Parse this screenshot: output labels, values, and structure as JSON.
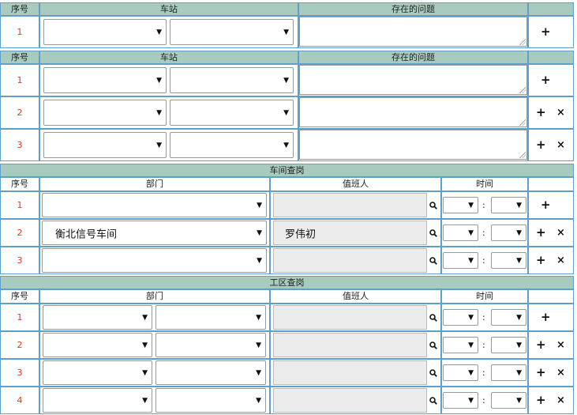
{
  "headers": {
    "seq": "序号",
    "station": "车站",
    "issue": "存在的问题",
    "dept": "部门",
    "onduty": "值班人",
    "time": "时间"
  },
  "sections": {
    "workshop_check": "车间查岗",
    "work_area_check": "工区查岗"
  },
  "section1_rows": [
    "1"
  ],
  "section2_rows": [
    "1",
    "2",
    "3"
  ],
  "workshop_rows": [
    {
      "seq": "1",
      "dept": "",
      "person": ""
    },
    {
      "seq": "2",
      "dept": "衡北信号车间",
      "person": "罗伟初"
    },
    {
      "seq": "3",
      "dept": "",
      "person": ""
    }
  ],
  "workarea_rows": [
    "1",
    "2",
    "3",
    "4"
  ],
  "glyphs": {
    "arrow": "▼",
    "add": "+",
    "remove": "×",
    "colon": ":"
  },
  "icons": {
    "add": "plus-icon",
    "remove": "close-icon",
    "search": "search-icon"
  }
}
